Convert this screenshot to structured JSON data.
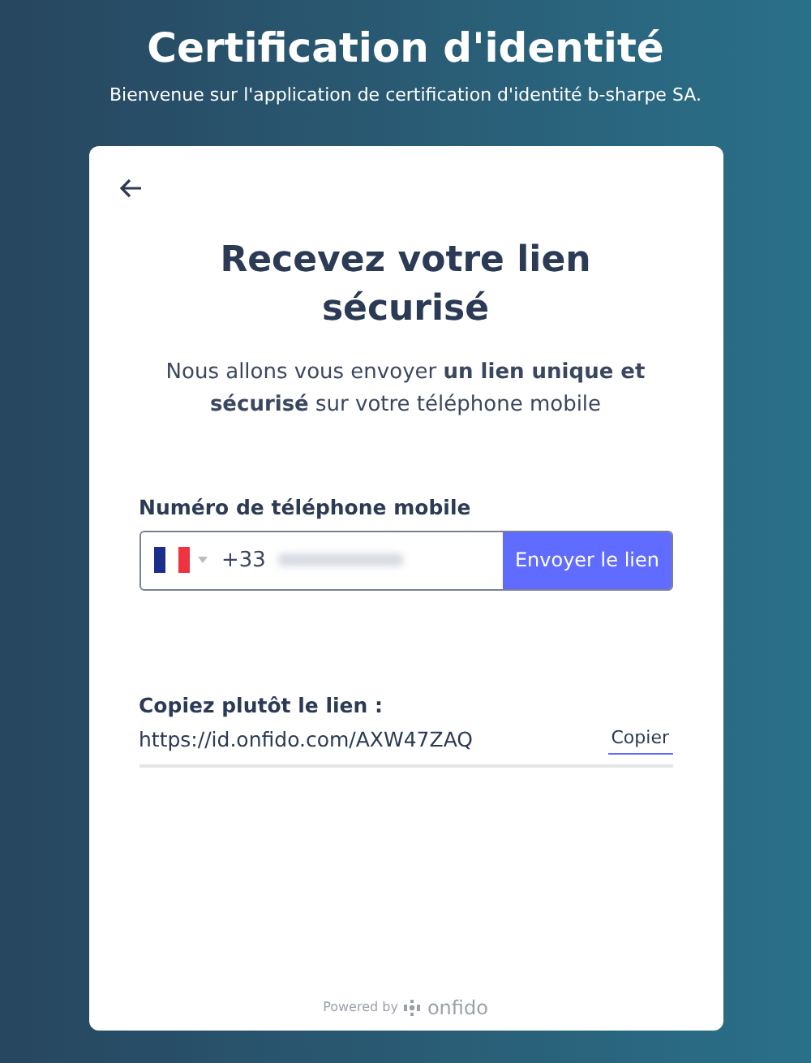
{
  "header": {
    "title": "Certification d'identité",
    "subtitle": "Bienvenue sur l'application de certification d'identité b-sharpe SA."
  },
  "card": {
    "title": "Recevez votre lien sécurisé",
    "description": "Nous allons vous envoyer **un lien unique et sécurisé** sur votre téléphone mobile",
    "phone": {
      "label": "Numéro de téléphone mobile",
      "prefix": "+33",
      "button": "Envoyer le lien"
    },
    "copy": {
      "label": "Copiez plutôt le lien :",
      "link": "https://id.onfido.com/AXW47ZAQ",
      "button": "Copier"
    },
    "footer": {
      "powered": "Powered by",
      "brand": "onfido"
    }
  }
}
